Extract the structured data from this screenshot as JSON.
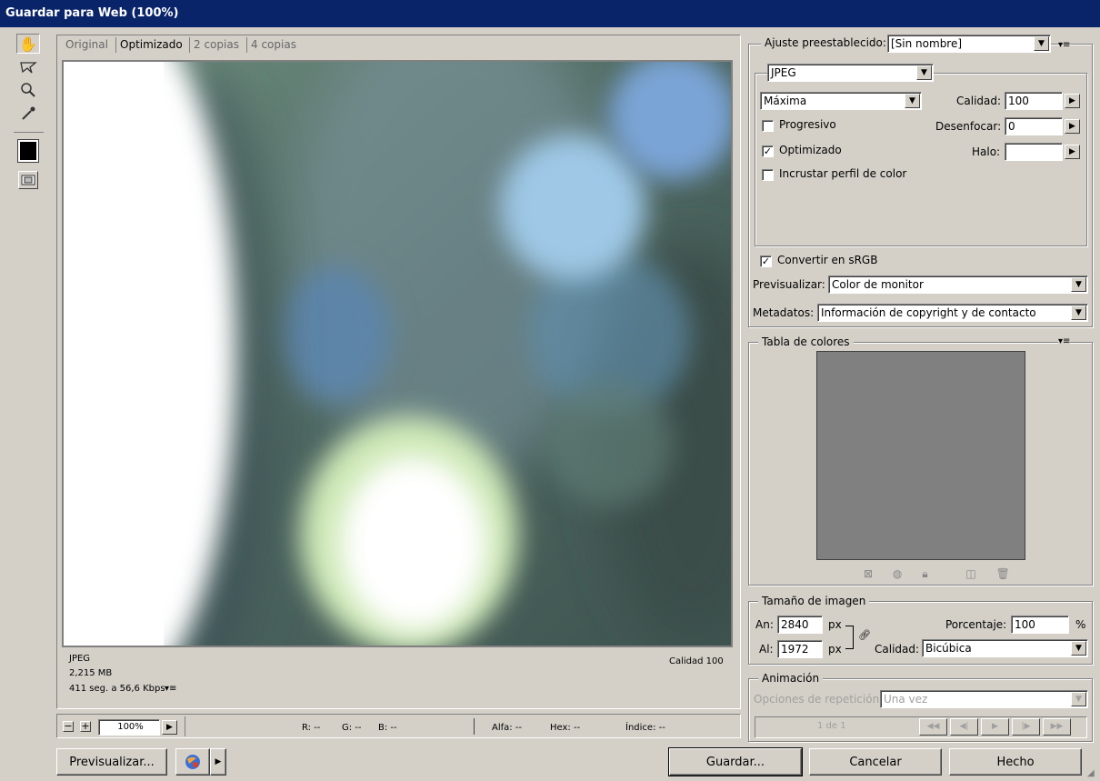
{
  "window": {
    "title": "Guardar para Web (100%)"
  },
  "tabs": [
    {
      "label": "Original"
    },
    {
      "label": "Optimizado"
    },
    {
      "label": "2 copias"
    },
    {
      "label": "4 copias"
    }
  ],
  "image_info": {
    "format": "JPEG",
    "size": "2,215 MB",
    "time": "411 seg. a 56,6 Kbps",
    "quality": "Calidad 100"
  },
  "settings": {
    "preset_label": "Ajuste preestablecido:",
    "preset_value": "[Sin nombre]",
    "format_value": "JPEG",
    "quality_preset": "Máxima",
    "quality_label": "Calidad:",
    "quality_value": "100",
    "progressive_label": "Progresivo",
    "progressive_checked": false,
    "blur_label": "Desenfocar:",
    "blur_value": "0",
    "optimized_label": "Optimizado",
    "optimized_checked": true,
    "matte_label": "Halo:",
    "matte_value": "",
    "embed_profile_label": "Incrustar perfil de color",
    "embed_profile_checked": false,
    "convert_srgb_label": "Convertir en sRGB",
    "convert_srgb_checked": true,
    "preview_label": "Previsualizar:",
    "preview_value": "Color de monitor",
    "metadata_label": "Metadatos:",
    "metadata_value": "Información de copyright y de contacto"
  },
  "color_table": {
    "title": "Tabla de colores",
    "swatch_color": "#808080"
  },
  "image_size": {
    "title": "Tamaño de imagen",
    "width_label": "An:",
    "width_value": "2840",
    "height_label": "Al:",
    "height_value": "1972",
    "unit": "px",
    "percent_label": "Porcentaje:",
    "percent_value": "100",
    "percent_unit": "%",
    "quality_label": "Calidad:",
    "quality_value": "Bicúbica"
  },
  "animation": {
    "title": "Animación",
    "loop_label": "Opciones de repetición:",
    "loop_value": "Una vez",
    "frame_text": "1 de 1"
  },
  "statusbar": {
    "zoom": "100%",
    "r": "R: --",
    "g": "G: --",
    "b": "B: --",
    "alpha": "Alfa: --",
    "hex": "Hex: --",
    "index": "Índice: --"
  },
  "buttons": {
    "preview": "Previsualizar...",
    "save": "Guardar...",
    "cancel": "Cancelar",
    "done": "Hecho"
  },
  "colors": {
    "titlebar": "#0a246a",
    "dialog_bg": "#d4d0c8"
  }
}
